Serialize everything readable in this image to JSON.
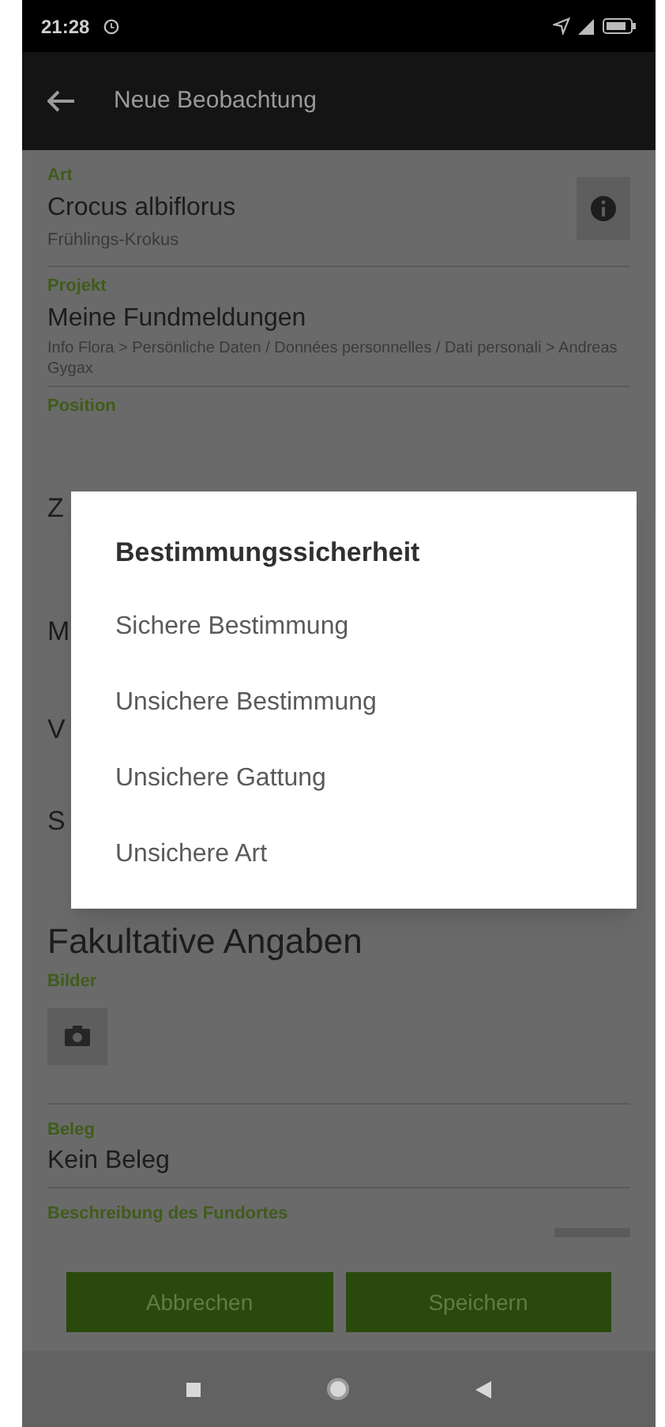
{
  "status_bar": {
    "time": "21:28"
  },
  "app_bar": {
    "title": "Neue Beobachtung"
  },
  "species": {
    "label": "Art",
    "value": "Crocus albiflorus",
    "subtitle": "Frühlings-Krokus"
  },
  "project": {
    "label": "Projekt",
    "value": "Meine Fundmeldungen",
    "subtitle": "Info Flora > Persönliche Daten / Données personnelles / Dati personali > Andreas Gygax"
  },
  "position": {
    "label": "Position"
  },
  "covered_fields": [
    {
      "value": "Z"
    },
    {
      "value": "M"
    },
    {
      "value": "V"
    },
    {
      "value": "S"
    }
  ],
  "dialog": {
    "title": "Bestimmungssicherheit",
    "options": [
      {
        "label": "Sichere Bestimmung"
      },
      {
        "label": "Unsichere Bestimmung"
      },
      {
        "label": "Unsichere Gattung"
      },
      {
        "label": "Unsichere Art"
      }
    ]
  },
  "optional_heading": "Fakultative Angaben",
  "images": {
    "label": "Bilder"
  },
  "voucher": {
    "label": "Beleg",
    "value": "Kein Beleg"
  },
  "site_description": {
    "label": "Beschreibung des Fundortes"
  },
  "buttons": [
    {
      "label": "Abbrechen"
    },
    {
      "label": "Speichern"
    }
  ]
}
